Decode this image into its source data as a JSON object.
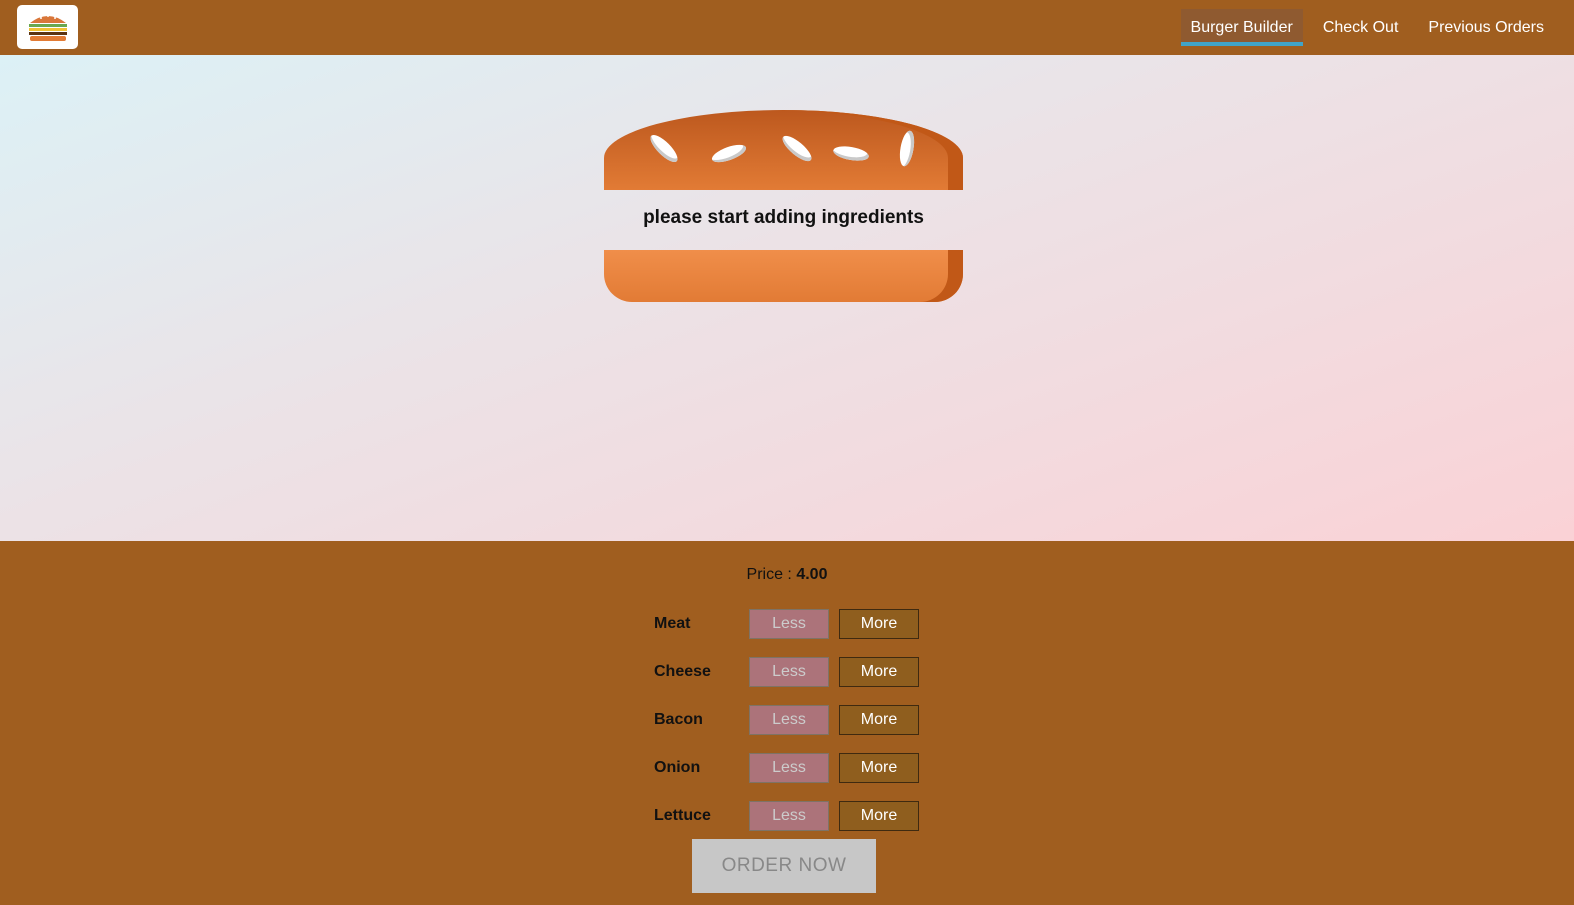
{
  "nav": {
    "items": [
      {
        "label": "Burger Builder",
        "active": true
      },
      {
        "label": "Check Out",
        "active": false
      },
      {
        "label": "Previous Orders",
        "active": false
      }
    ]
  },
  "burger": {
    "message": "please start adding ingredients"
  },
  "controls": {
    "price_label": "Price :",
    "price_value": "4.00",
    "less_label": "Less",
    "more_label": "More",
    "ingredients": [
      "Meat",
      "Cheese",
      "Bacon",
      "Onion",
      "Lettuce"
    ],
    "order_label": "ORDER NOW"
  },
  "colors": {
    "toolbar": "#a05e1f",
    "nav_active_underline": "#40a4c8",
    "bread": "#e27b35",
    "more_button": "#8f5e1e",
    "less_button": "#ac737a",
    "order_button": "#c7c7c7"
  }
}
